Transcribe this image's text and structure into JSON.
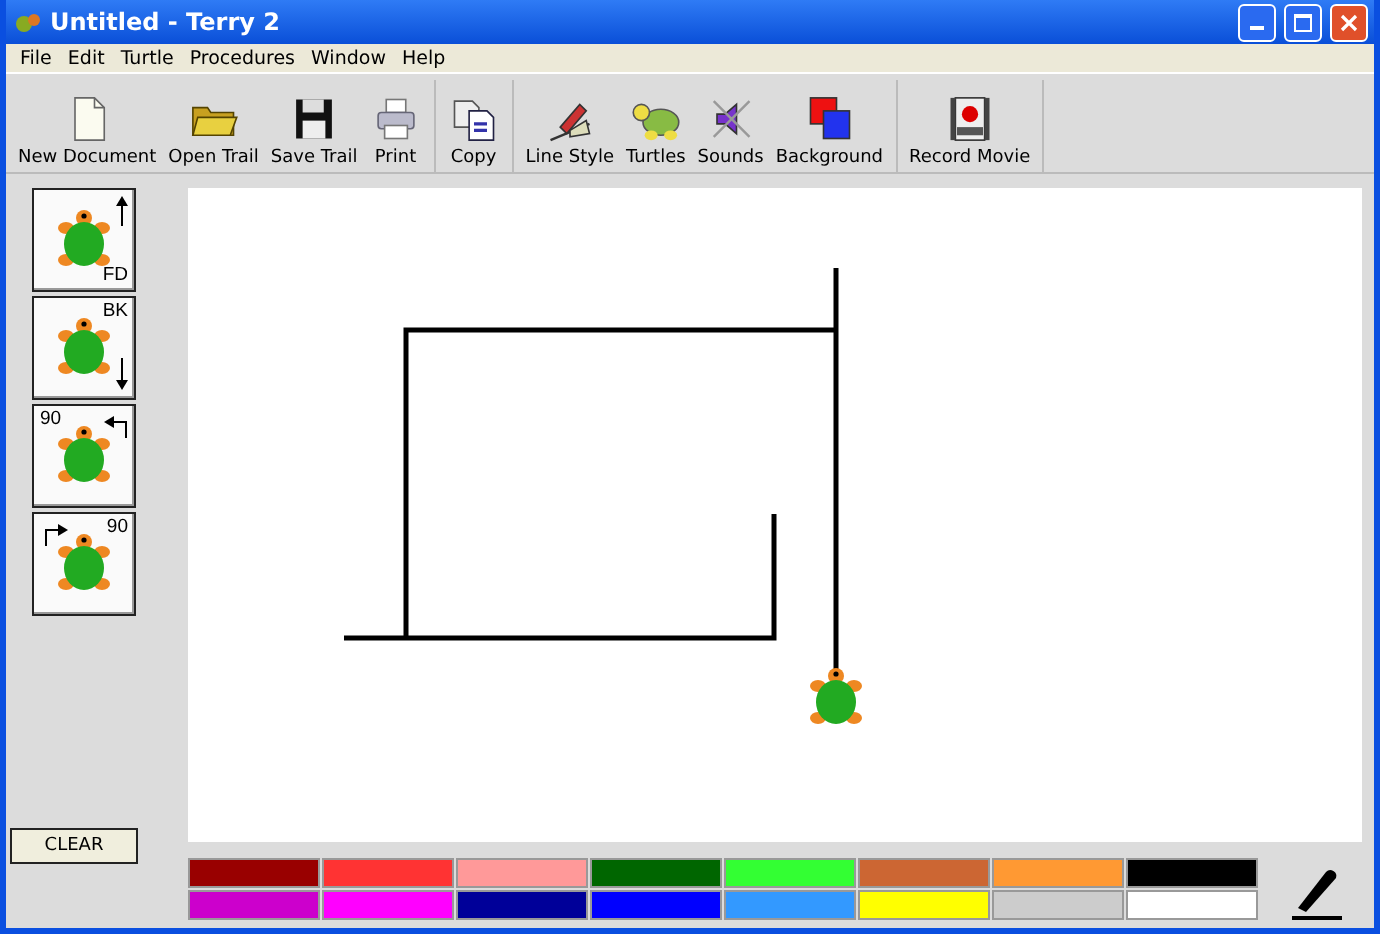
{
  "window": {
    "title": "Untitled - Terry 2"
  },
  "menu": [
    "File",
    "Edit",
    "Turtle",
    "Procedures",
    "Window",
    "Help"
  ],
  "toolbar_groups": [
    [
      {
        "kind": "new",
        "label": "New Document"
      },
      {
        "kind": "open",
        "label": "Open Trail"
      },
      {
        "kind": "save",
        "label": "Save Trail"
      },
      {
        "kind": "print",
        "label": "Print"
      }
    ],
    [
      {
        "kind": "copy",
        "label": "Copy"
      }
    ],
    [
      {
        "kind": "linestyle",
        "label": "Line Style"
      },
      {
        "kind": "turtles",
        "label": "Turtles"
      },
      {
        "kind": "sounds",
        "label": "Sounds"
      },
      {
        "kind": "background",
        "label": "Background"
      }
    ],
    [
      {
        "kind": "movie",
        "label": "Record Movie"
      }
    ]
  ],
  "commands": [
    {
      "kind": "forward",
      "label": "FD"
    },
    {
      "kind": "back",
      "label": "BK"
    },
    {
      "kind": "left",
      "label": "90"
    },
    {
      "kind": "right",
      "label": "90"
    }
  ],
  "clear_button": "CLEAR",
  "palette": [
    {
      "color": "#990000"
    },
    {
      "color": "#ff3333"
    },
    {
      "color": "#ff9999"
    },
    {
      "color": "#006600"
    },
    {
      "color": "#33ff33"
    },
    {
      "color": "#cc6633"
    },
    {
      "color": "#ff9933"
    },
    {
      "color": "#000000"
    },
    {
      "color": "#cc00cc"
    },
    {
      "color": "#ff00ff"
    },
    {
      "color": "#000099"
    },
    {
      "color": "#0000ff"
    },
    {
      "color": "#3399ff"
    },
    {
      "color": "#ffff00"
    },
    {
      "color": "#cccccc"
    },
    {
      "color": "#ffffff"
    }
  ]
}
